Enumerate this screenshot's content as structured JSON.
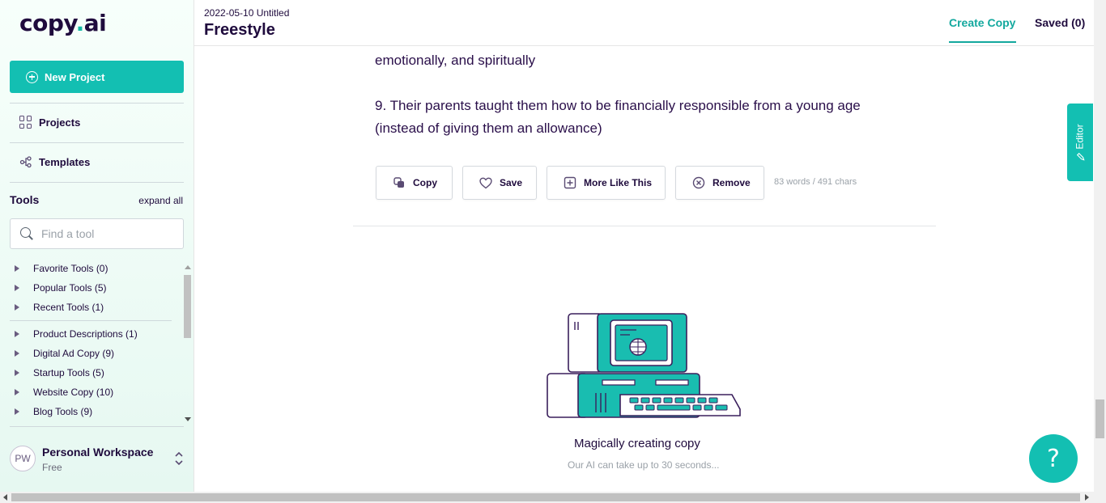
{
  "sidebar": {
    "logo_text": "copy",
    "logo_dot": ".",
    "logo_suffix": "ai",
    "new_project_label": "New Project",
    "projects_label": "Projects",
    "templates_label": "Templates",
    "tools_heading": "Tools",
    "expand_all": "expand all",
    "find_tool_placeholder": "Find a tool",
    "tools": [
      {
        "label": "Favorite Tools (0)"
      },
      {
        "label": "Popular Tools (5)"
      },
      {
        "label": "Recent Tools (1)"
      },
      {
        "label": "Product Descriptions (1)"
      },
      {
        "label": "Digital Ad Copy (9)"
      },
      {
        "label": "Startup Tools (5)"
      },
      {
        "label": "Website Copy (10)"
      },
      {
        "label": "Blog Tools (9)"
      }
    ],
    "workspace": {
      "initials": "PW",
      "name": "Personal Workspace",
      "plan": "Free"
    }
  },
  "header": {
    "doc_date": "2022-05-10 Untitled",
    "doc_title": "Freestyle",
    "tab_create": "Create Copy",
    "tab_saved": "Saved (0)"
  },
  "content": {
    "line_partial": "emotionally, and spiritually",
    "item_9_line1": "9. Their parents taught them how to be financially responsible from a young age",
    "item_9_line2": "(instead of giving them an allowance)",
    "actions": {
      "copy": "Copy",
      "save": "Save",
      "more": "More Like This",
      "remove": "Remove"
    },
    "word_count": "83 words / 491 chars",
    "loading_title": "Magically creating copy",
    "loading_sub": "Our AI can take up to 30 seconds..."
  },
  "editor_tab": "Editor",
  "help_label": "?",
  "colors": {
    "accent": "#13bfb2",
    "accent_dark": "#13a89e",
    "text": "#1f0b3d"
  }
}
